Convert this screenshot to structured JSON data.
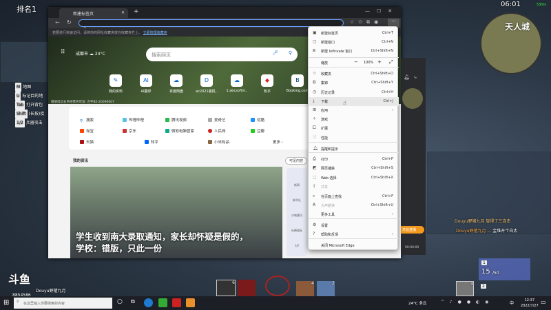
{
  "game": {
    "rank": "排名1",
    "time": "06:01",
    "ping": "53ms",
    "map_title": "天人城",
    "keys": [
      {
        "key": "M",
        "label": "地图"
      },
      {
        "key": "U",
        "label": "标记目的地"
      },
      {
        "key": "Tab",
        "label": "打开背包"
      },
      {
        "key": "Shift",
        "label": "(长按)疾"
      },
      {
        "key": "1/2",
        "label": "兵器攻击"
      }
    ],
    "chat": [
      {
        "user": "Douyu野猪九月",
        "msg": "旋得了三连击"
      },
      {
        "user": "Douyu野猪九月",
        "msg": "金堆开个白太"
      }
    ],
    "weapon": {
      "slot": "1",
      "ammo": "15",
      "ammo_max": "/50",
      "slot2": "2"
    },
    "item_count": "3",
    "streamer": {
      "logo": "斗鱼",
      "name": "Douyu野猪九月",
      "room": "8854586"
    },
    "skill_counts": [
      "6",
      "4",
      "2"
    ]
  },
  "browser": {
    "tab_title": "新建标签页",
    "info_bar": "若要进行快速访问，请将你的网址收藏夹放在收藏夹栏上。",
    "info_link": "立即管理收藏夹",
    "city": "成都市",
    "temp": "24°C",
    "search_placeholder": "搜索网页",
    "quick_links": [
      "我的资料",
      "AI翻译",
      "百度网盘",
      "ac2021装机..",
      "1.abcsoftm..",
      "知乎",
      "Booking.com"
    ],
    "icp": "增值电信业务经营许可证: 合字B2-20090007",
    "links": [
      "搜索",
      "哔哩哔哩",
      "腾讯视频",
      "爱奇艺",
      "优酷",
      "淘宝",
      "京东",
      "微软电脑管家",
      "人民网",
      "豆瓣",
      "天猫",
      "知乎",
      "小米有品",
      "更多"
    ],
    "news_title": "我的资讯",
    "news_btn": "可见内容",
    "headline1": "学生收到南大录取通知，家长却怀疑是假的，",
    "headline2": "学校：错版，只此一份",
    "side_labels": [
      "新闻",
      "新华社",
      "沙城通讯",
      "杜德国际"
    ],
    "pager": "1/2"
  },
  "menu": {
    "items": [
      {
        "icon": "new-tab",
        "label": "新建标签页",
        "shortcut": "Ctrl+T"
      },
      {
        "icon": "new-window",
        "label": "新建窗口",
        "shortcut": "Ctrl+N"
      },
      {
        "icon": "inprivate",
        "label": "新建 InPrivate 窗口",
        "shortcut": "Ctrl+Shift+N"
      },
      {
        "icon": "favorites",
        "label": "收藏夹",
        "shortcut": "Ctrl+Shift+O"
      },
      {
        "icon": "collections",
        "label": "集锦",
        "shortcut": "Ctrl+Shift+Y"
      },
      {
        "icon": "history",
        "label": "历史记录",
        "shortcut": "Ctrl+H"
      },
      {
        "icon": "download",
        "label": "下载",
        "shortcut": "Ctrl+J"
      },
      {
        "icon": "apps",
        "label": "应用",
        "shortcut": "›"
      },
      {
        "icon": "games",
        "label": "游戏",
        "shortcut": ""
      },
      {
        "icon": "extensions",
        "label": "扩展",
        "shortcut": ""
      },
      {
        "icon": "performance",
        "label": "性能",
        "shortcut": ""
      },
      {
        "icon": "bell",
        "label": "提醒和提示",
        "shortcut": ""
      },
      {
        "icon": "print",
        "label": "打印",
        "shortcut": "Ctrl+P"
      },
      {
        "icon": "capture",
        "label": "网页捕获",
        "shortcut": "Ctrl+Shift+S"
      },
      {
        "icon": "web-select",
        "label": "Web 选择",
        "shortcut": "Ctrl+Shift+X"
      },
      {
        "icon": "share",
        "label": "共享",
        "shortcut": ""
      },
      {
        "icon": "find",
        "label": "在页面上查找",
        "shortcut": "Ctrl+F"
      },
      {
        "icon": "read-aloud",
        "label": "大声朗读",
        "shortcut": "Ctrl+Shift+U"
      },
      {
        "icon": "more-tools",
        "label": "更多工具",
        "shortcut": "›"
      },
      {
        "icon": "settings",
        "label": "设置",
        "shortcut": ""
      },
      {
        "icon": "help",
        "label": "帮助和反馈",
        "shortcut": "›"
      },
      {
        "icon": "close",
        "label": "关闭 Microsoft Edge",
        "shortcut": ""
      }
    ],
    "zoom_label": "缩放",
    "zoom_value": "100%"
  },
  "side_panel": {
    "live_btn": "开始直播",
    "timer": "00:00:00"
  },
  "taskbar": {
    "search_placeholder": "在这里输入你要搜索的内容",
    "weather": "24°C 多云",
    "ime": "中",
    "time": "12:37",
    "date": "2022/7/27"
  }
}
